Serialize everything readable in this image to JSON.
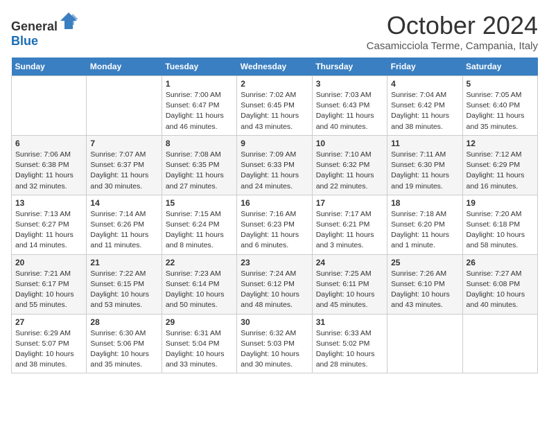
{
  "header": {
    "logo": {
      "text1": "General",
      "text2": "Blue"
    },
    "title": "October 2024",
    "location": "Casamicciola Terme, Campania, Italy"
  },
  "days_of_week": [
    "Sunday",
    "Monday",
    "Tuesday",
    "Wednesday",
    "Thursday",
    "Friday",
    "Saturday"
  ],
  "weeks": [
    [
      {
        "day": "",
        "sunrise": "",
        "sunset": "",
        "daylight": ""
      },
      {
        "day": "",
        "sunrise": "",
        "sunset": "",
        "daylight": ""
      },
      {
        "day": "1",
        "sunrise": "Sunrise: 7:00 AM",
        "sunset": "Sunset: 6:47 PM",
        "daylight": "Daylight: 11 hours and 46 minutes."
      },
      {
        "day": "2",
        "sunrise": "Sunrise: 7:02 AM",
        "sunset": "Sunset: 6:45 PM",
        "daylight": "Daylight: 11 hours and 43 minutes."
      },
      {
        "day": "3",
        "sunrise": "Sunrise: 7:03 AM",
        "sunset": "Sunset: 6:43 PM",
        "daylight": "Daylight: 11 hours and 40 minutes."
      },
      {
        "day": "4",
        "sunrise": "Sunrise: 7:04 AM",
        "sunset": "Sunset: 6:42 PM",
        "daylight": "Daylight: 11 hours and 38 minutes."
      },
      {
        "day": "5",
        "sunrise": "Sunrise: 7:05 AM",
        "sunset": "Sunset: 6:40 PM",
        "daylight": "Daylight: 11 hours and 35 minutes."
      }
    ],
    [
      {
        "day": "6",
        "sunrise": "Sunrise: 7:06 AM",
        "sunset": "Sunset: 6:38 PM",
        "daylight": "Daylight: 11 hours and 32 minutes."
      },
      {
        "day": "7",
        "sunrise": "Sunrise: 7:07 AM",
        "sunset": "Sunset: 6:37 PM",
        "daylight": "Daylight: 11 hours and 30 minutes."
      },
      {
        "day": "8",
        "sunrise": "Sunrise: 7:08 AM",
        "sunset": "Sunset: 6:35 PM",
        "daylight": "Daylight: 11 hours and 27 minutes."
      },
      {
        "day": "9",
        "sunrise": "Sunrise: 7:09 AM",
        "sunset": "Sunset: 6:33 PM",
        "daylight": "Daylight: 11 hours and 24 minutes."
      },
      {
        "day": "10",
        "sunrise": "Sunrise: 7:10 AM",
        "sunset": "Sunset: 6:32 PM",
        "daylight": "Daylight: 11 hours and 22 minutes."
      },
      {
        "day": "11",
        "sunrise": "Sunrise: 7:11 AM",
        "sunset": "Sunset: 6:30 PM",
        "daylight": "Daylight: 11 hours and 19 minutes."
      },
      {
        "day": "12",
        "sunrise": "Sunrise: 7:12 AM",
        "sunset": "Sunset: 6:29 PM",
        "daylight": "Daylight: 11 hours and 16 minutes."
      }
    ],
    [
      {
        "day": "13",
        "sunrise": "Sunrise: 7:13 AM",
        "sunset": "Sunset: 6:27 PM",
        "daylight": "Daylight: 11 hours and 14 minutes."
      },
      {
        "day": "14",
        "sunrise": "Sunrise: 7:14 AM",
        "sunset": "Sunset: 6:26 PM",
        "daylight": "Daylight: 11 hours and 11 minutes."
      },
      {
        "day": "15",
        "sunrise": "Sunrise: 7:15 AM",
        "sunset": "Sunset: 6:24 PM",
        "daylight": "Daylight: 11 hours and 8 minutes."
      },
      {
        "day": "16",
        "sunrise": "Sunrise: 7:16 AM",
        "sunset": "Sunset: 6:23 PM",
        "daylight": "Daylight: 11 hours and 6 minutes."
      },
      {
        "day": "17",
        "sunrise": "Sunrise: 7:17 AM",
        "sunset": "Sunset: 6:21 PM",
        "daylight": "Daylight: 11 hours and 3 minutes."
      },
      {
        "day": "18",
        "sunrise": "Sunrise: 7:18 AM",
        "sunset": "Sunset: 6:20 PM",
        "daylight": "Daylight: 11 hours and 1 minute."
      },
      {
        "day": "19",
        "sunrise": "Sunrise: 7:20 AM",
        "sunset": "Sunset: 6:18 PM",
        "daylight": "Daylight: 10 hours and 58 minutes."
      }
    ],
    [
      {
        "day": "20",
        "sunrise": "Sunrise: 7:21 AM",
        "sunset": "Sunset: 6:17 PM",
        "daylight": "Daylight: 10 hours and 55 minutes."
      },
      {
        "day": "21",
        "sunrise": "Sunrise: 7:22 AM",
        "sunset": "Sunset: 6:15 PM",
        "daylight": "Daylight: 10 hours and 53 minutes."
      },
      {
        "day": "22",
        "sunrise": "Sunrise: 7:23 AM",
        "sunset": "Sunset: 6:14 PM",
        "daylight": "Daylight: 10 hours and 50 minutes."
      },
      {
        "day": "23",
        "sunrise": "Sunrise: 7:24 AM",
        "sunset": "Sunset: 6:12 PM",
        "daylight": "Daylight: 10 hours and 48 minutes."
      },
      {
        "day": "24",
        "sunrise": "Sunrise: 7:25 AM",
        "sunset": "Sunset: 6:11 PM",
        "daylight": "Daylight: 10 hours and 45 minutes."
      },
      {
        "day": "25",
        "sunrise": "Sunrise: 7:26 AM",
        "sunset": "Sunset: 6:10 PM",
        "daylight": "Daylight: 10 hours and 43 minutes."
      },
      {
        "day": "26",
        "sunrise": "Sunrise: 7:27 AM",
        "sunset": "Sunset: 6:08 PM",
        "daylight": "Daylight: 10 hours and 40 minutes."
      }
    ],
    [
      {
        "day": "27",
        "sunrise": "Sunrise: 6:29 AM",
        "sunset": "Sunset: 5:07 PM",
        "daylight": "Daylight: 10 hours and 38 minutes."
      },
      {
        "day": "28",
        "sunrise": "Sunrise: 6:30 AM",
        "sunset": "Sunset: 5:06 PM",
        "daylight": "Daylight: 10 hours and 35 minutes."
      },
      {
        "day": "29",
        "sunrise": "Sunrise: 6:31 AM",
        "sunset": "Sunset: 5:04 PM",
        "daylight": "Daylight: 10 hours and 33 minutes."
      },
      {
        "day": "30",
        "sunrise": "Sunrise: 6:32 AM",
        "sunset": "Sunset: 5:03 PM",
        "daylight": "Daylight: 10 hours and 30 minutes."
      },
      {
        "day": "31",
        "sunrise": "Sunrise: 6:33 AM",
        "sunset": "Sunset: 5:02 PM",
        "daylight": "Daylight: 10 hours and 28 minutes."
      },
      {
        "day": "",
        "sunrise": "",
        "sunset": "",
        "daylight": ""
      },
      {
        "day": "",
        "sunrise": "",
        "sunset": "",
        "daylight": ""
      }
    ]
  ]
}
